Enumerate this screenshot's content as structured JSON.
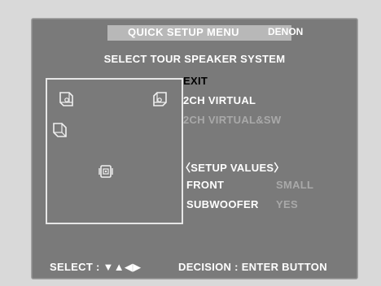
{
  "menu": {
    "title": "QUICK SETUP MENU",
    "brand": "DENON",
    "heading": "SELECT TOUR SPEAKER SYSTEM",
    "options": [
      "EXIT",
      "2CH VIRTUAL",
      "2CH VIRTUAL&SW"
    ],
    "selected_index": 0
  },
  "setup_values": {
    "title": "〈SETUP VALUES〉",
    "front_label": "FRONT",
    "front_value": "SMALL",
    "subwoofer_label": "SUBWOOFER",
    "subwoofer_value": "YES"
  },
  "footer": {
    "select_label": "SELECT :",
    "select_arrows": "▼▲◀▶",
    "decision": "DECISION : ENTER BUTTON"
  },
  "icons": [
    "front-left-speaker-icon",
    "front-right-speaker-icon",
    "surround-left-speaker-icon",
    "subwoofer-icon"
  ],
  "colors": {
    "screen": "#7a7a7a",
    "title_bar": "#b8b8b8",
    "disabled_text": "#a9a9a9",
    "selected_text": "#000000"
  }
}
